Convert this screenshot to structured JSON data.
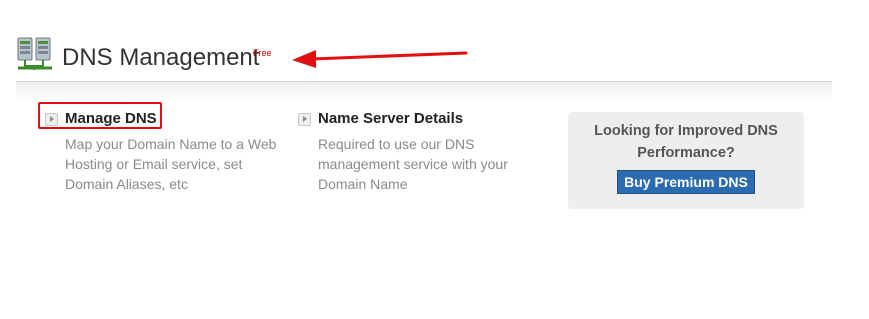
{
  "header": {
    "icon": "server-network-icon",
    "title": "DNS Management",
    "badge": "Free"
  },
  "options": [
    {
      "icon": "play-arrow-icon",
      "title": "Manage DNS",
      "description": "Map your Domain Name to a Web Hosting or Email service, set Domain Aliases, etc"
    },
    {
      "icon": "play-arrow-icon",
      "title": "Name Server Details",
      "description": "Required to use our DNS management service with your Domain Name"
    }
  ],
  "promo": {
    "text": "Looking for Improved DNS Performance?",
    "button_label": "Buy Premium DNS",
    "button_color": "#2b6cb0"
  },
  "annotations": {
    "highlight_color": "#e01010",
    "arrow_color": "#e01010"
  }
}
